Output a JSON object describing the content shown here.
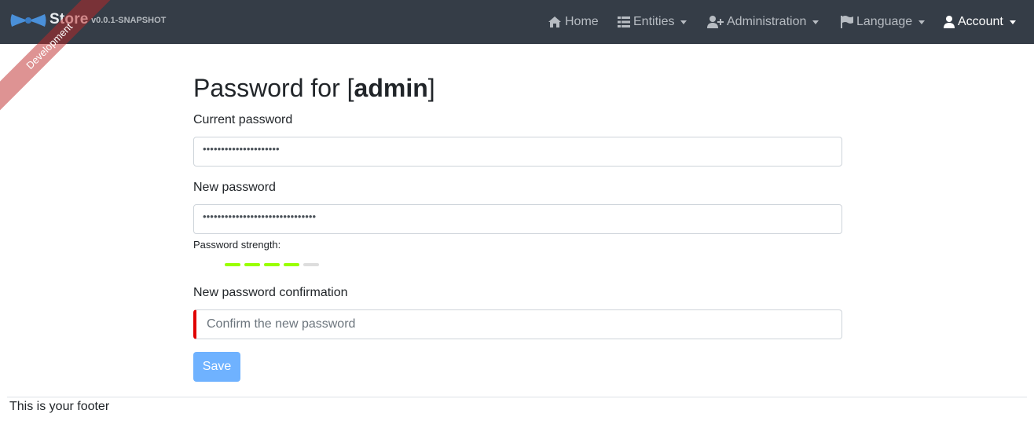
{
  "brand": {
    "name": "Store",
    "version": "v0.0.1-SNAPSHOT",
    "logo_icon": "bowtie-logo-icon"
  },
  "ribbon": {
    "label": "Development"
  },
  "nav": {
    "items": [
      {
        "label": "Home",
        "icon": "home-icon",
        "dropdown": false,
        "active": false
      },
      {
        "label": "Entities",
        "icon": "list-icon",
        "dropdown": true,
        "active": false
      },
      {
        "label": "Administration",
        "icon": "user-plus-icon",
        "dropdown": true,
        "active": false
      },
      {
        "label": "Language",
        "icon": "flag-icon",
        "dropdown": true,
        "active": false
      },
      {
        "label": "Account",
        "icon": "user-icon",
        "dropdown": true,
        "active": true
      }
    ]
  },
  "page": {
    "title_prefix": "Password for [",
    "username": "admin",
    "title_suffix": "]"
  },
  "form": {
    "current_password": {
      "label": "Current password",
      "masked_value": "•••••••••••••••••••••"
    },
    "new_password": {
      "label": "New password",
      "masked_value": "•••••••••••••••••••••••••••••••"
    },
    "strength": {
      "label": "Password strength:",
      "level": 4,
      "max": 5,
      "color": "#99ff00"
    },
    "confirm_password": {
      "label": "New password confirmation",
      "placeholder": "Confirm the new password"
    },
    "save_label": "Save"
  },
  "footer": {
    "text": "This is your footer"
  },
  "colors": {
    "navbar": "#353d47",
    "primary_button": "#6fb2ff",
    "invalid": "#e00000"
  }
}
